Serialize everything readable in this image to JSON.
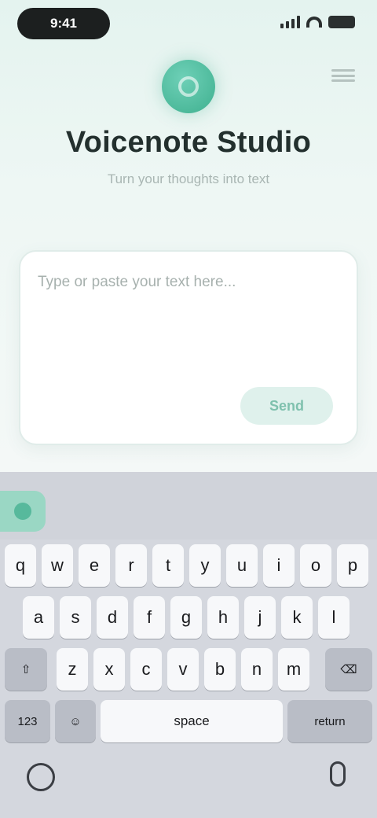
{
  "status_bar": {
    "time": "9:41"
  },
  "header": {
    "title": "Voicenote Studio",
    "subtitle": "Turn your thoughts into text"
  },
  "composer": {
    "placeholder": "Type or paste your text here...",
    "value": "",
    "send_label": "Send"
  },
  "keyboard": {
    "row1": [
      "q",
      "w",
      "e",
      "r",
      "t",
      "y",
      "u",
      "i",
      "o",
      "p"
    ],
    "row2": [
      "a",
      "s",
      "d",
      "f",
      "g",
      "h",
      "j",
      "k",
      "l"
    ],
    "row3": [
      "z",
      "x",
      "c",
      "v",
      "b",
      "n",
      "m"
    ],
    "shift": "⇧",
    "delete": "⌫",
    "numbers": "123",
    "emoji": "☺",
    "space": "space",
    "return": "return"
  },
  "colors": {
    "accent": "#3fb08f",
    "background": "#eef5f3"
  }
}
